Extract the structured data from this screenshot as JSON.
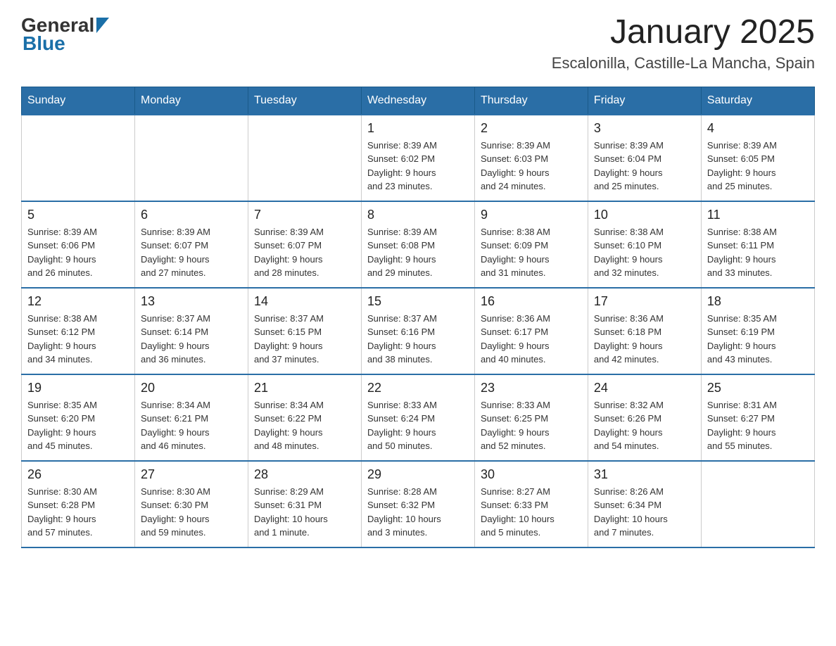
{
  "header": {
    "logo_general": "General",
    "logo_blue": "Blue",
    "month_title": "January 2025",
    "location": "Escalonilla, Castille-La Mancha, Spain"
  },
  "days_of_week": [
    "Sunday",
    "Monday",
    "Tuesday",
    "Wednesday",
    "Thursday",
    "Friday",
    "Saturday"
  ],
  "weeks": [
    {
      "cells": [
        {
          "day": "",
          "info": ""
        },
        {
          "day": "",
          "info": ""
        },
        {
          "day": "",
          "info": ""
        },
        {
          "day": "1",
          "info": "Sunrise: 8:39 AM\nSunset: 6:02 PM\nDaylight: 9 hours\nand 23 minutes."
        },
        {
          "day": "2",
          "info": "Sunrise: 8:39 AM\nSunset: 6:03 PM\nDaylight: 9 hours\nand 24 minutes."
        },
        {
          "day": "3",
          "info": "Sunrise: 8:39 AM\nSunset: 6:04 PM\nDaylight: 9 hours\nand 25 minutes."
        },
        {
          "day": "4",
          "info": "Sunrise: 8:39 AM\nSunset: 6:05 PM\nDaylight: 9 hours\nand 25 minutes."
        }
      ]
    },
    {
      "cells": [
        {
          "day": "5",
          "info": "Sunrise: 8:39 AM\nSunset: 6:06 PM\nDaylight: 9 hours\nand 26 minutes."
        },
        {
          "day": "6",
          "info": "Sunrise: 8:39 AM\nSunset: 6:07 PM\nDaylight: 9 hours\nand 27 minutes."
        },
        {
          "day": "7",
          "info": "Sunrise: 8:39 AM\nSunset: 6:07 PM\nDaylight: 9 hours\nand 28 minutes."
        },
        {
          "day": "8",
          "info": "Sunrise: 8:39 AM\nSunset: 6:08 PM\nDaylight: 9 hours\nand 29 minutes."
        },
        {
          "day": "9",
          "info": "Sunrise: 8:38 AM\nSunset: 6:09 PM\nDaylight: 9 hours\nand 31 minutes."
        },
        {
          "day": "10",
          "info": "Sunrise: 8:38 AM\nSunset: 6:10 PM\nDaylight: 9 hours\nand 32 minutes."
        },
        {
          "day": "11",
          "info": "Sunrise: 8:38 AM\nSunset: 6:11 PM\nDaylight: 9 hours\nand 33 minutes."
        }
      ]
    },
    {
      "cells": [
        {
          "day": "12",
          "info": "Sunrise: 8:38 AM\nSunset: 6:12 PM\nDaylight: 9 hours\nand 34 minutes."
        },
        {
          "day": "13",
          "info": "Sunrise: 8:37 AM\nSunset: 6:14 PM\nDaylight: 9 hours\nand 36 minutes."
        },
        {
          "day": "14",
          "info": "Sunrise: 8:37 AM\nSunset: 6:15 PM\nDaylight: 9 hours\nand 37 minutes."
        },
        {
          "day": "15",
          "info": "Sunrise: 8:37 AM\nSunset: 6:16 PM\nDaylight: 9 hours\nand 38 minutes."
        },
        {
          "day": "16",
          "info": "Sunrise: 8:36 AM\nSunset: 6:17 PM\nDaylight: 9 hours\nand 40 minutes."
        },
        {
          "day": "17",
          "info": "Sunrise: 8:36 AM\nSunset: 6:18 PM\nDaylight: 9 hours\nand 42 minutes."
        },
        {
          "day": "18",
          "info": "Sunrise: 8:35 AM\nSunset: 6:19 PM\nDaylight: 9 hours\nand 43 minutes."
        }
      ]
    },
    {
      "cells": [
        {
          "day": "19",
          "info": "Sunrise: 8:35 AM\nSunset: 6:20 PM\nDaylight: 9 hours\nand 45 minutes."
        },
        {
          "day": "20",
          "info": "Sunrise: 8:34 AM\nSunset: 6:21 PM\nDaylight: 9 hours\nand 46 minutes."
        },
        {
          "day": "21",
          "info": "Sunrise: 8:34 AM\nSunset: 6:22 PM\nDaylight: 9 hours\nand 48 minutes."
        },
        {
          "day": "22",
          "info": "Sunrise: 8:33 AM\nSunset: 6:24 PM\nDaylight: 9 hours\nand 50 minutes."
        },
        {
          "day": "23",
          "info": "Sunrise: 8:33 AM\nSunset: 6:25 PM\nDaylight: 9 hours\nand 52 minutes."
        },
        {
          "day": "24",
          "info": "Sunrise: 8:32 AM\nSunset: 6:26 PM\nDaylight: 9 hours\nand 54 minutes."
        },
        {
          "day": "25",
          "info": "Sunrise: 8:31 AM\nSunset: 6:27 PM\nDaylight: 9 hours\nand 55 minutes."
        }
      ]
    },
    {
      "cells": [
        {
          "day": "26",
          "info": "Sunrise: 8:30 AM\nSunset: 6:28 PM\nDaylight: 9 hours\nand 57 minutes."
        },
        {
          "day": "27",
          "info": "Sunrise: 8:30 AM\nSunset: 6:30 PM\nDaylight: 9 hours\nand 59 minutes."
        },
        {
          "day": "28",
          "info": "Sunrise: 8:29 AM\nSunset: 6:31 PM\nDaylight: 10 hours\nand 1 minute."
        },
        {
          "day": "29",
          "info": "Sunrise: 8:28 AM\nSunset: 6:32 PM\nDaylight: 10 hours\nand 3 minutes."
        },
        {
          "day": "30",
          "info": "Sunrise: 8:27 AM\nSunset: 6:33 PM\nDaylight: 10 hours\nand 5 minutes."
        },
        {
          "day": "31",
          "info": "Sunrise: 8:26 AM\nSunset: 6:34 PM\nDaylight: 10 hours\nand 7 minutes."
        },
        {
          "day": "",
          "info": ""
        }
      ]
    }
  ]
}
